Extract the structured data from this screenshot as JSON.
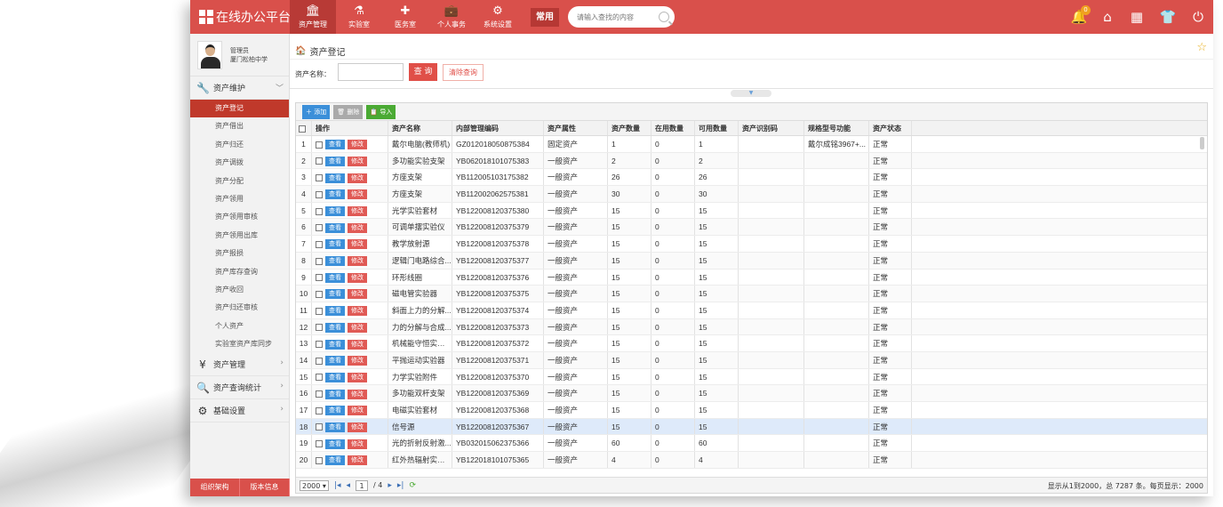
{
  "app": {
    "title": "在线办公平台"
  },
  "nav": [
    {
      "label": "资产管理",
      "icon": "bank-icon"
    },
    {
      "label": "实验室",
      "icon": "flask-icon"
    },
    {
      "label": "医务室",
      "icon": "medical-cross-icon"
    },
    {
      "label": "个人事务",
      "icon": "briefcase-icon"
    },
    {
      "label": "系统设置",
      "icon": "gears-icon"
    }
  ],
  "common_label": "常用",
  "search": {
    "placeholder": "请输入查找的内容"
  },
  "notification_count": "0",
  "user": {
    "role": "管理员",
    "org": "厦门松柏中学"
  },
  "sidebar": {
    "groups": [
      {
        "label": "资产维护",
        "expanded": true
      },
      {
        "label": "资产管理"
      },
      {
        "label": "资产查询统计"
      },
      {
        "label": "基础设置"
      }
    ],
    "sub_items": [
      "资产登记",
      "资产借出",
      "资产归还",
      "资产调拨",
      "资产分配",
      "资产领用",
      "资产领用审核",
      "资产领用出库",
      "资产报损",
      "资产库存查询",
      "资产收回",
      "资产归还审核",
      "个人资产",
      "实验室资产库同步"
    ],
    "footer": [
      "组织架构",
      "版本信息"
    ]
  },
  "breadcrumb": "资产登记",
  "query": {
    "label": "资产名称：",
    "query_button": "查 询",
    "clear_button": "清除查询"
  },
  "toolbar": {
    "add": "添加",
    "delete": "删除",
    "import": "导入"
  },
  "table": {
    "headers": [
      "",
      "操作",
      "资产名称",
      "内部管理编码",
      "资产属性",
      "资产数量",
      "在用数量",
      "可用数量",
      "资产识别码",
      "规格型号功能",
      "资产状态"
    ],
    "view_label": "查看",
    "edit_label": "修改",
    "rows": [
      [
        "1",
        "戴尔电脑(教师机)",
        "GZ012018050875384",
        "固定资产",
        "1",
        "0",
        "1",
        "",
        "戴尔成铭3967+...",
        "正常"
      ],
      [
        "2",
        "多功能实验支架",
        "YB062018101075383",
        "一般资产",
        "2",
        "0",
        "2",
        "",
        "",
        "正常"
      ],
      [
        "3",
        "方座支架",
        "YB112005103175382",
        "一般资产",
        "26",
        "0",
        "26",
        "",
        "",
        "正常"
      ],
      [
        "4",
        "方座支架",
        "YB112002062575381",
        "一般资产",
        "30",
        "0",
        "30",
        "",
        "",
        "正常"
      ],
      [
        "5",
        "光学实验套材",
        "YB122008120375380",
        "一般资产",
        "15",
        "0",
        "15",
        "",
        "",
        "正常"
      ],
      [
        "6",
        "可调单摆实验仪",
        "YB122008120375379",
        "一般资产",
        "15",
        "0",
        "15",
        "",
        "",
        "正常"
      ],
      [
        "7",
        "教学放射源",
        "YB122008120375378",
        "一般资产",
        "15",
        "0",
        "15",
        "",
        "",
        "正常"
      ],
      [
        "8",
        "逻辑门电路综合...",
        "YB122008120375377",
        "一般资产",
        "15",
        "0",
        "15",
        "",
        "",
        "正常"
      ],
      [
        "9",
        "环形线圈",
        "YB122008120375376",
        "一般资产",
        "15",
        "0",
        "15",
        "",
        "",
        "正常"
      ],
      [
        "10",
        "磁电管实验器",
        "YB122008120375375",
        "一般资产",
        "15",
        "0",
        "15",
        "",
        "",
        "正常"
      ],
      [
        "11",
        "斜面上力的分解...",
        "YB122008120375374",
        "一般资产",
        "15",
        "0",
        "15",
        "",
        "",
        "正常"
      ],
      [
        "12",
        "力的分解与合成...",
        "YB122008120375373",
        "一般资产",
        "15",
        "0",
        "15",
        "",
        "",
        "正常"
      ],
      [
        "13",
        "机械能守恒实验器",
        "YB122008120375372",
        "一般资产",
        "15",
        "0",
        "15",
        "",
        "",
        "正常"
      ],
      [
        "14",
        "平抛运动实验器",
        "YB122008120375371",
        "一般资产",
        "15",
        "0",
        "15",
        "",
        "",
        "正常"
      ],
      [
        "15",
        "力学实验附件",
        "YB122008120375370",
        "一般资产",
        "15",
        "0",
        "15",
        "",
        "",
        "正常"
      ],
      [
        "16",
        "多功能双杆支架",
        "YB122008120375369",
        "一般资产",
        "15",
        "0",
        "15",
        "",
        "",
        "正常"
      ],
      [
        "17",
        "电磁实验套材",
        "YB122008120375368",
        "一般资产",
        "15",
        "0",
        "15",
        "",
        "",
        "正常"
      ],
      [
        "18",
        "信号源",
        "YB122008120375367",
        "一般资产",
        "15",
        "0",
        "15",
        "",
        "",
        "正常"
      ],
      [
        "19",
        "光的折射反射激...",
        "YB032015062375366",
        "一般资产",
        "60",
        "0",
        "60",
        "",
        "",
        "正常"
      ],
      [
        "20",
        "红外热辐射实验仪",
        "YB122018101075365",
        "一般资产",
        "4",
        "0",
        "4",
        "",
        "",
        "正常"
      ]
    ],
    "selected_row": 18
  },
  "pager": {
    "page_size": "2000",
    "page": "1",
    "total_pages": "/ 4",
    "info": "显示从1到2000，总 7287 条。每页显示：2000"
  }
}
